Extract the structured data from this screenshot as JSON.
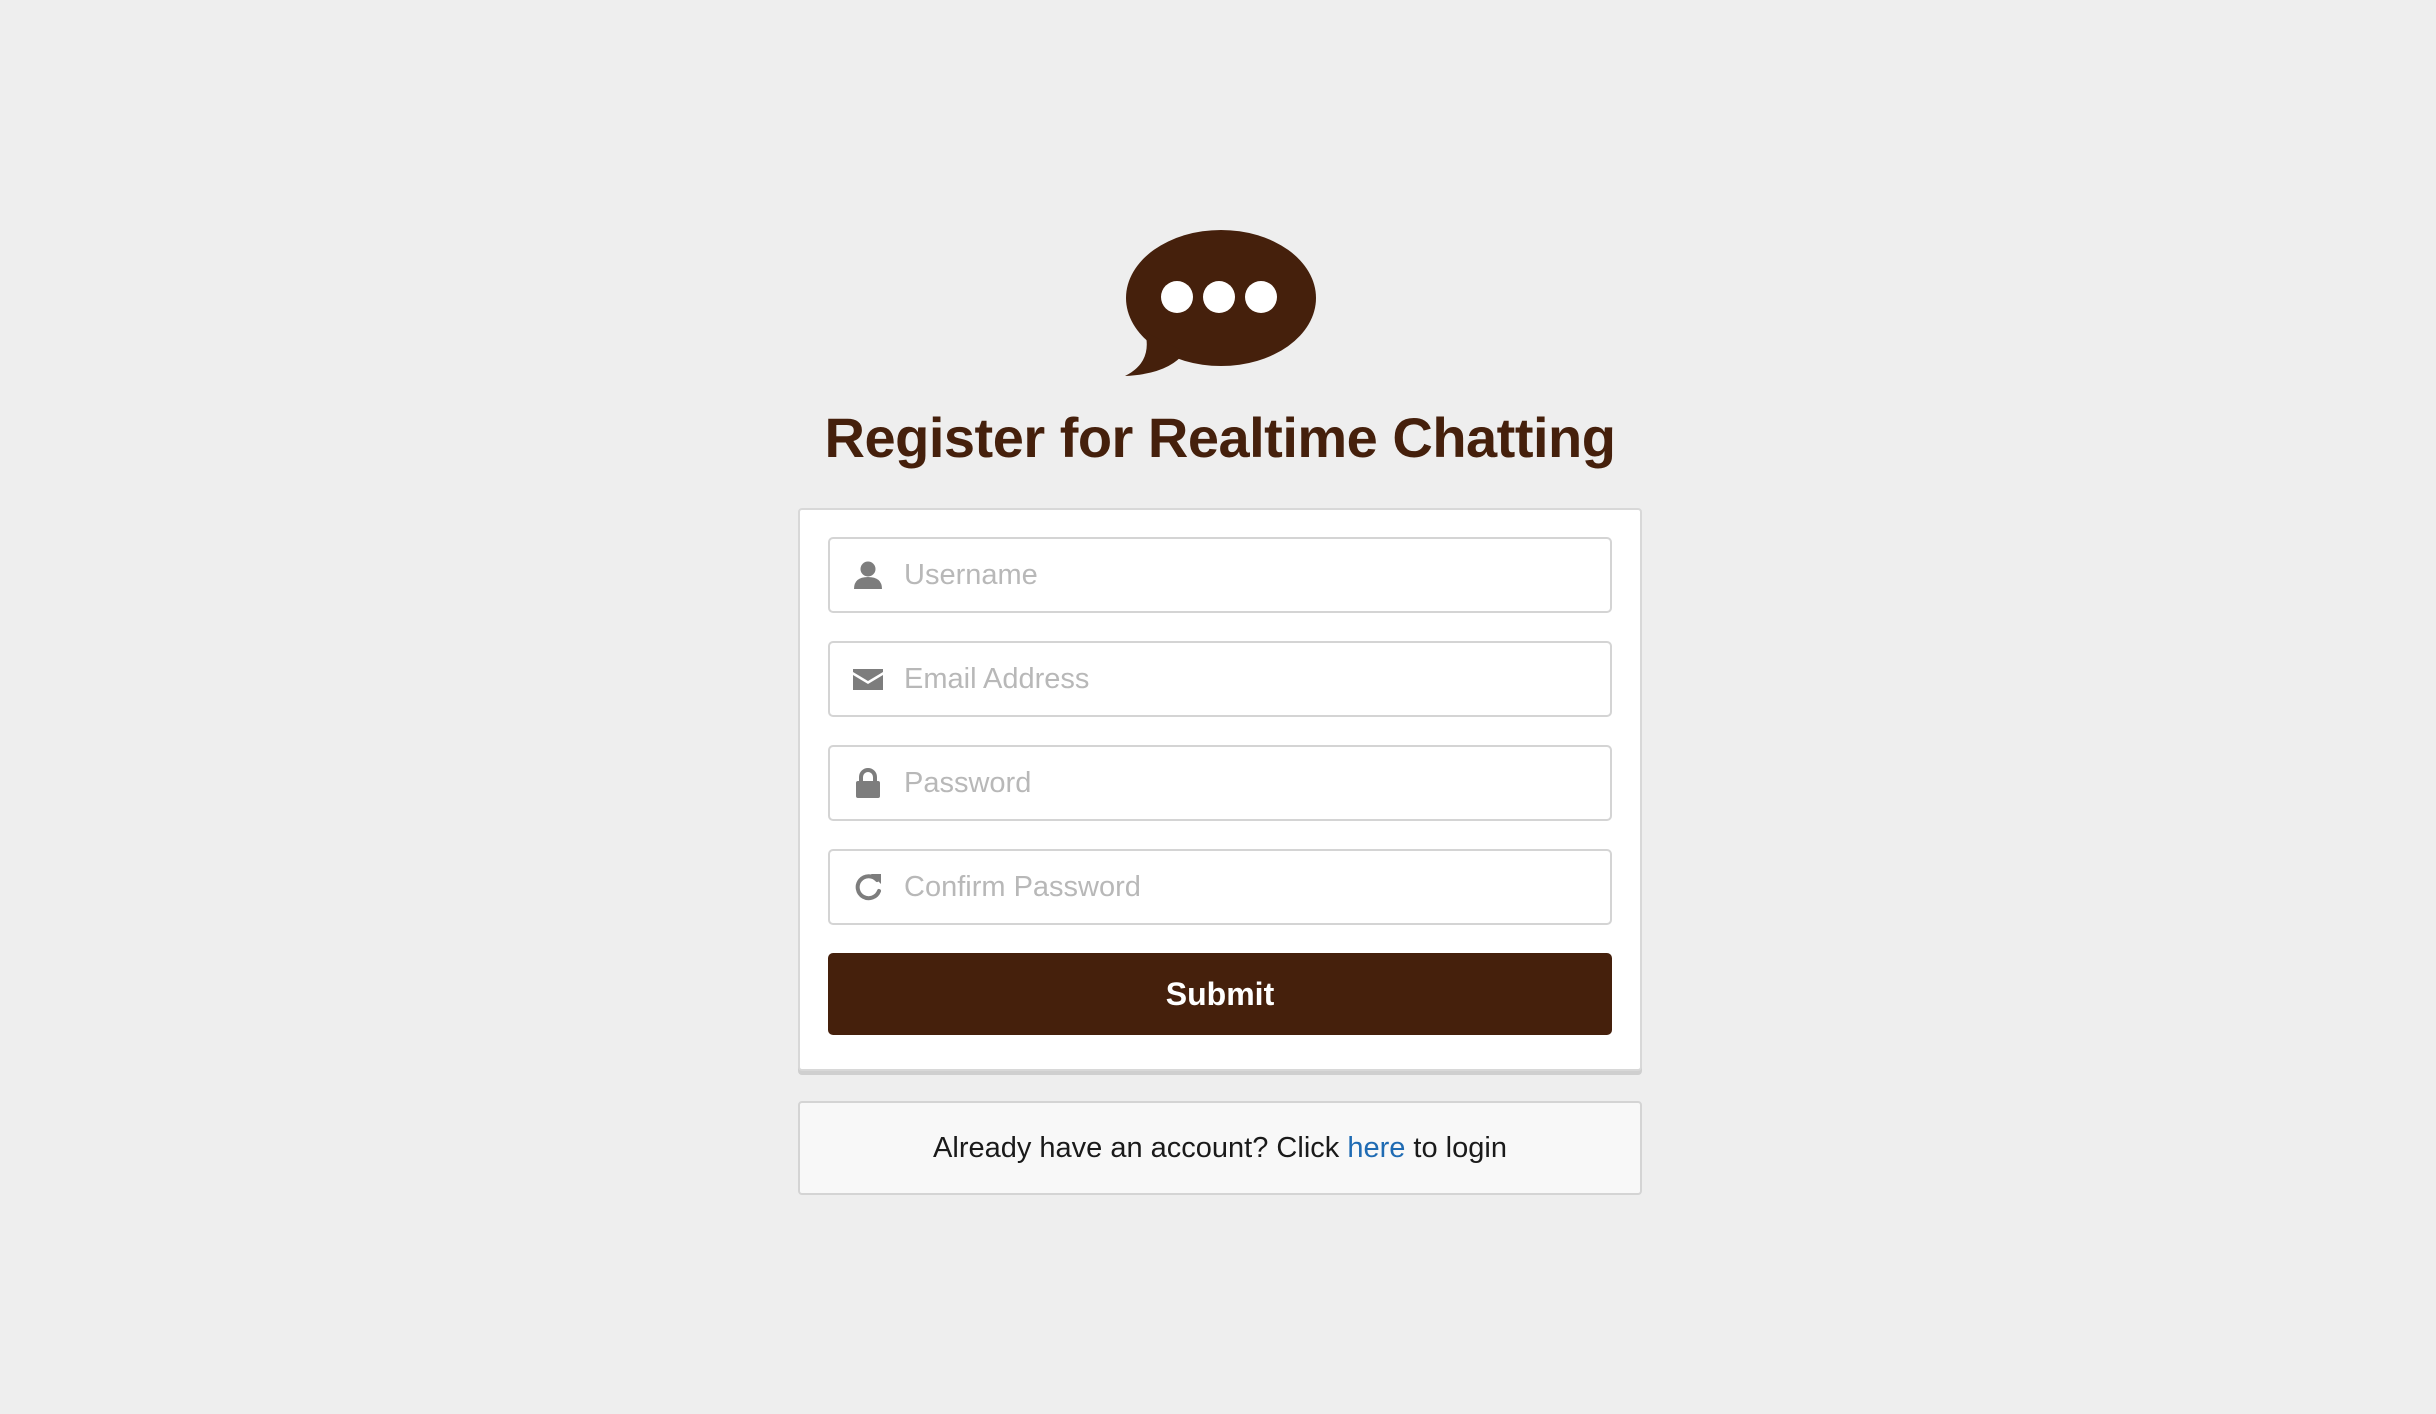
{
  "brand": {
    "logo_icon": "speech-bubble-ellipsis-icon",
    "accent_color": "#45200c",
    "link_color": "#1f6bb3"
  },
  "page": {
    "title": "Register for Realtime Chatting"
  },
  "form": {
    "fields": [
      {
        "icon": "user-icon",
        "placeholder": "Username",
        "value": ""
      },
      {
        "icon": "envelope-icon",
        "placeholder": "Email Address",
        "value": ""
      },
      {
        "icon": "lock-icon",
        "placeholder": "Password",
        "value": ""
      },
      {
        "icon": "refresh-icon",
        "placeholder": "Confirm Password",
        "value": ""
      }
    ],
    "submit_label": "Submit"
  },
  "login_prompt": {
    "prefix": "Already have an account? Click ",
    "link_text": "here",
    "suffix": " to login"
  }
}
